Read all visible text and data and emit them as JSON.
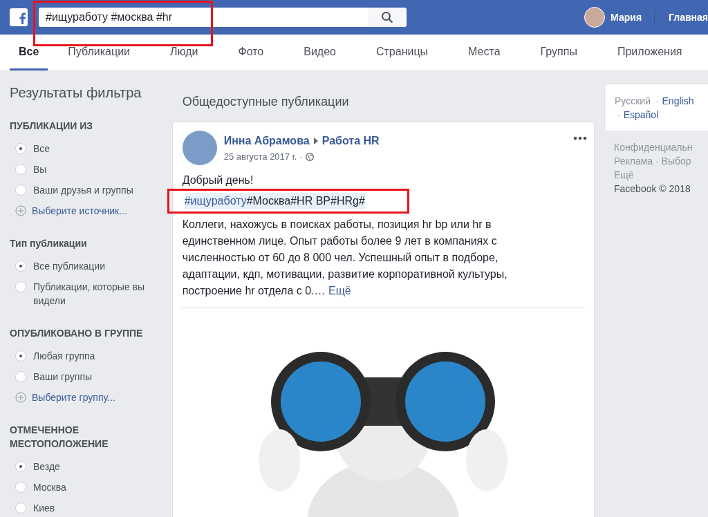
{
  "top_bar": {
    "search": {
      "value": "#ищуработу #москва #hr",
      "highlighted": true
    },
    "user_name": "Мария",
    "home_link": "Главная"
  },
  "tabs": [
    {
      "label": "Все",
      "selected": true
    },
    {
      "label": "Публикации",
      "selected": false
    },
    {
      "label": "Люди",
      "selected": false
    },
    {
      "label": "Фото",
      "selected": false
    },
    {
      "label": "Видео",
      "selected": false
    },
    {
      "label": "Страницы",
      "selected": false
    },
    {
      "label": "Места",
      "selected": false
    },
    {
      "label": "Группы",
      "selected": false
    },
    {
      "label": "Приложения",
      "selected": false
    }
  ],
  "filters": {
    "title": "Результаты фильтра",
    "sections": [
      {
        "heading": "ПУБЛИКАЦИИ ИЗ",
        "options": [
          {
            "label": "Все",
            "selected": true
          },
          {
            "label": "Вы",
            "selected": false
          },
          {
            "label": "Ваши друзья и группы",
            "selected": false
          }
        ],
        "add_link": "Выберите источник..."
      },
      {
        "heading": "Тип публикации",
        "options": [
          {
            "label": "Все публикации",
            "selected": true
          },
          {
            "label": "Публикации, которые вы видели",
            "selected": false
          }
        ]
      },
      {
        "heading": "ОПУБЛИКОВАНО В ГРУППЕ",
        "options": [
          {
            "label": "Любая группа",
            "selected": true
          },
          {
            "label": "Ваши группы",
            "selected": false
          }
        ],
        "add_link": "Выберите группу..."
      },
      {
        "heading": "ОТМЕЧЕННОЕ МЕСТОПОЛОЖЕНИЕ",
        "options": [
          {
            "label": "Везде",
            "selected": true
          },
          {
            "label": "Москва",
            "selected": false
          },
          {
            "label": "Киев",
            "selected": false
          }
        ]
      }
    ]
  },
  "results": {
    "heading": "Общедоступные публикации",
    "post": {
      "author": "Инна Абрамова",
      "group": "Работа HR",
      "date": "25 августа 2017 г. ·",
      "greeting": "Добрый день!",
      "hashtags": {
        "link": "#ищуработу",
        "rest": "#Москва#HR BP#HRg#",
        "highlighted": true
      },
      "text": "Коллеги, нахожусь в поисках работы, позиция hr bp или hr в единственном лице. Опыт работы более 9 лет в компаниях с численностью от 60 до 8 000 чел. Успешный опыт в подборе, адаптации, кдп, мотивации, развитие корпоративной культуры, построение hr отдела с 0.…",
      "more_link": "Ещё"
    }
  },
  "right_column": {
    "separator": "·",
    "languages": [
      {
        "label": "Русский",
        "current": true
      },
      {
        "label": "English",
        "current": false
      },
      {
        "label": "Español",
        "current": false
      }
    ],
    "footer": [
      "Конфиденциальн",
      "Реклама · Выбор",
      "Ещё",
      "Facebook © 2018"
    ]
  }
}
